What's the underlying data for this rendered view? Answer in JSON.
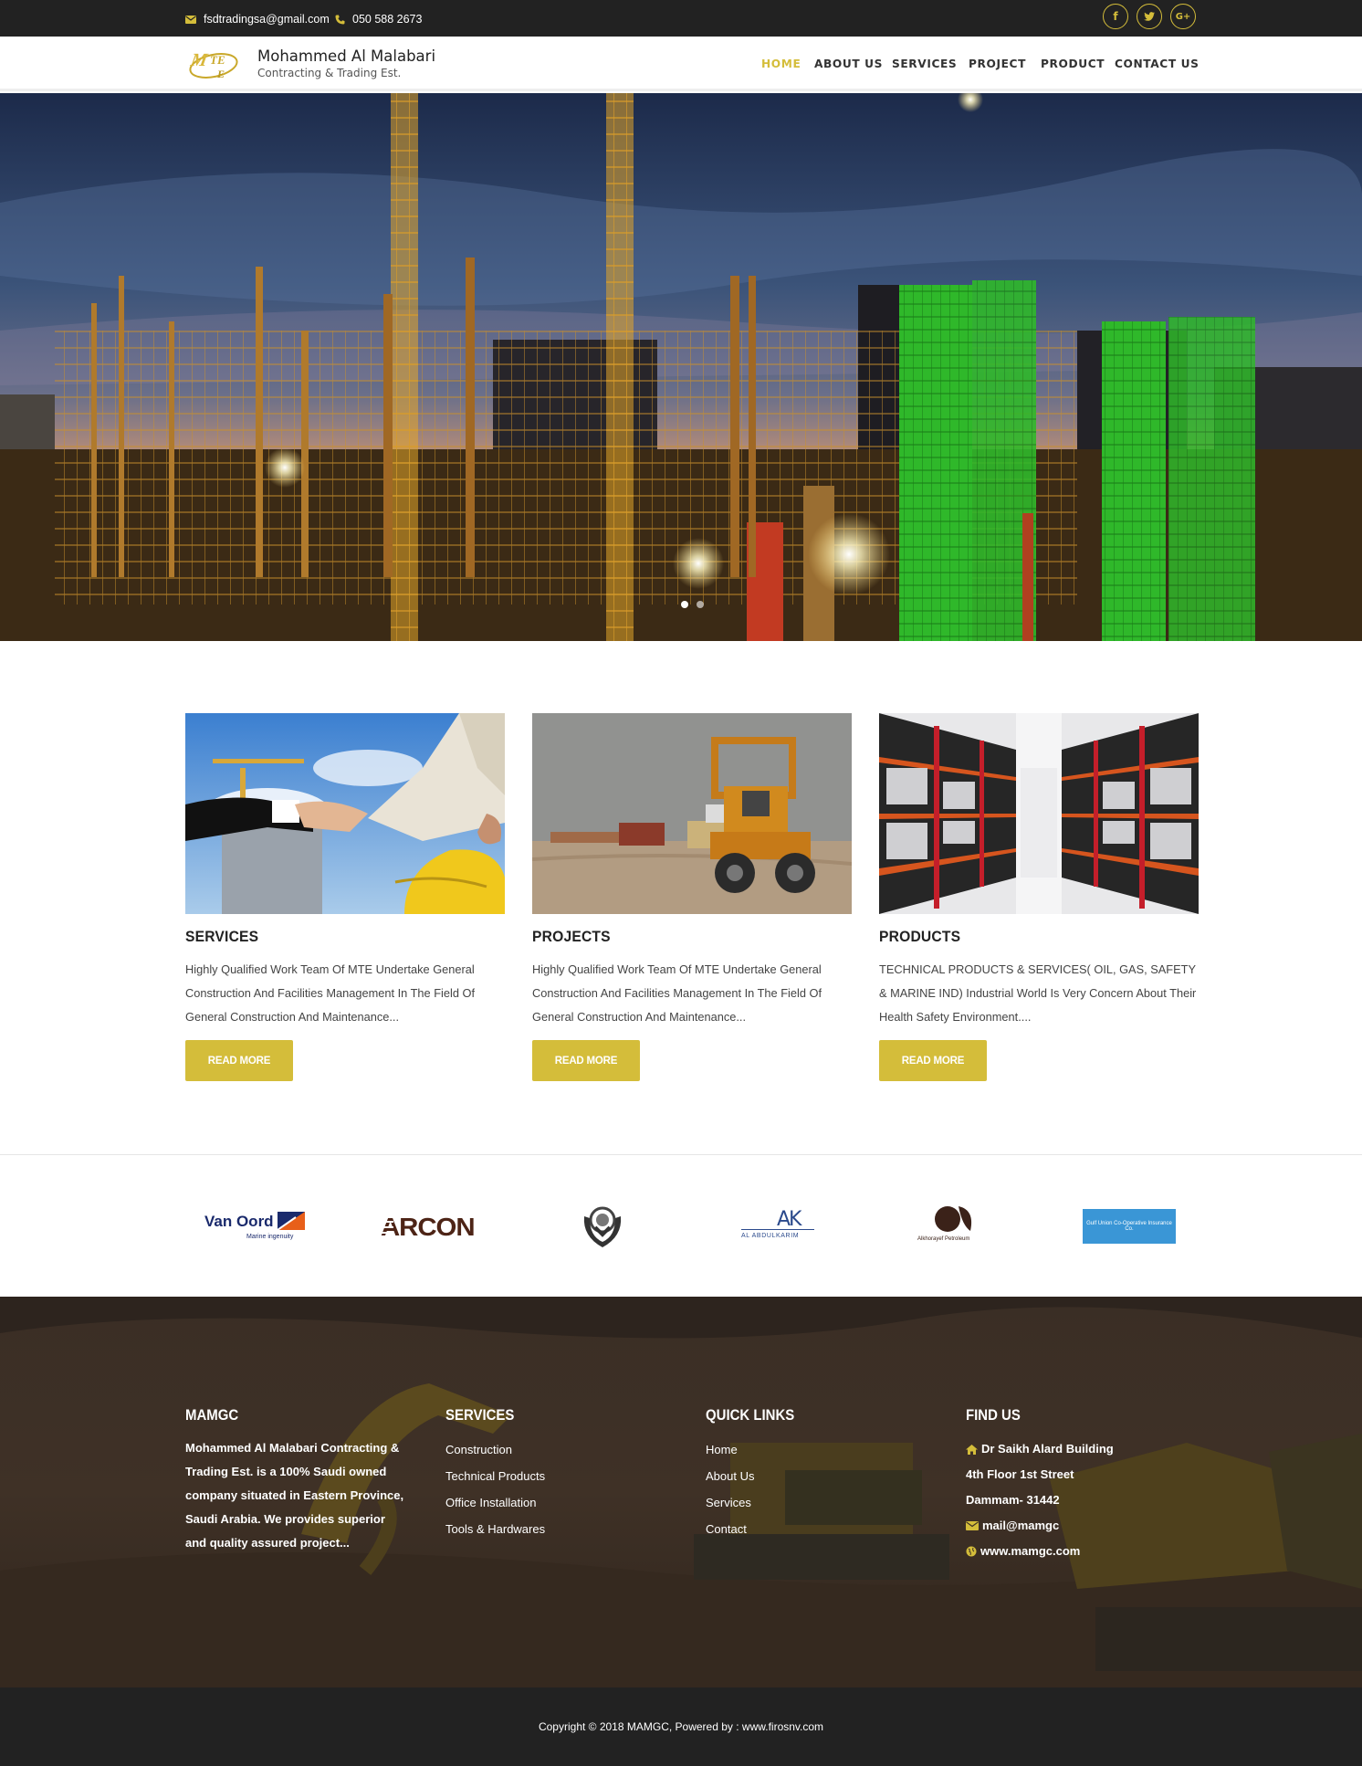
{
  "topbar": {
    "email": "fsdtradingsa@gmail.com",
    "phone": "050 588 2673",
    "social": [
      {
        "icon": "facebook-icon",
        "glyph": "f"
      },
      {
        "icon": "twitter-icon",
        "glyph": "t"
      },
      {
        "icon": "google-plus-icon",
        "glyph": "G+"
      }
    ]
  },
  "header": {
    "logo_text": "MTE",
    "company_name": "Mohammed Al Malabari",
    "company_sub": "Contracting & Trading Est.",
    "nav": [
      {
        "label": "HOME",
        "active": true
      },
      {
        "label": "ABOUT US",
        "active": false
      },
      {
        "label": "SERVICES",
        "active": false
      },
      {
        "label": "PROJECT",
        "active": false
      },
      {
        "label": "PRODUCT",
        "active": false
      },
      {
        "label": "CONTACT US",
        "active": false
      }
    ]
  },
  "cards": [
    {
      "title": "SERVICES",
      "text": "Highly Qualified Work Team Of MTE Undertake General Construction And Facilities Management In The Field Of General Construction And Maintenance...",
      "button": "READ MORE"
    },
    {
      "title": "PROJECTS",
      "text": "Highly Qualified Work Team Of MTE Undertake General Construction And Facilities Management In The Field Of General Construction And Maintenance...",
      "button": "READ MORE"
    },
    {
      "title": "PRODUCTS",
      "text": "TECHNICAL PRODUCTS & SERVICES( OIL, GAS, SAFETY & MARINE IND) Industrial World Is Very Concern About Their Health Safety Environment....",
      "button": "READ MORE"
    }
  ],
  "partners": {
    "vanoord_name": "Van Oord",
    "vanoord_tag": "Marine ingenuity",
    "arcon": "ARCON",
    "ak_letters": "AK",
    "ak_name": "AL ABDULKARIM",
    "petroleum": "Alkhorayef Petroleum",
    "gulf_union": "Gulf Union Co-Operative Insurance Co."
  },
  "footer": {
    "about_head": "MAMGC",
    "about_text": "Mohammed Al Malabari Contracting & Trading Est. is a 100% Saudi owned company situated in Eastern Province, Saudi Arabia. We provides superior and quality assured project...",
    "services_head": "SERVICES",
    "services": [
      "Construction",
      "Technical Products",
      "Office Installation",
      "Tools & Hardwares"
    ],
    "links_head": "QUICK LINKS",
    "links": [
      "Home",
      "About Us",
      "Services",
      "Contact"
    ],
    "find_head": "FIND US",
    "find_line1": "Dr Saikh Alard Building",
    "find_line2": "4th Floor 1st Street",
    "find_line3": "Dammam- 31442",
    "find_mail": "mail@mamgc",
    "find_web": "www.mamgc.com"
  },
  "copyright": "Copyright © 2018 MAMGC, Powered by : www.firosnv.com",
  "colors": {
    "accent": "#d4bd3a",
    "dark": "#222222"
  }
}
